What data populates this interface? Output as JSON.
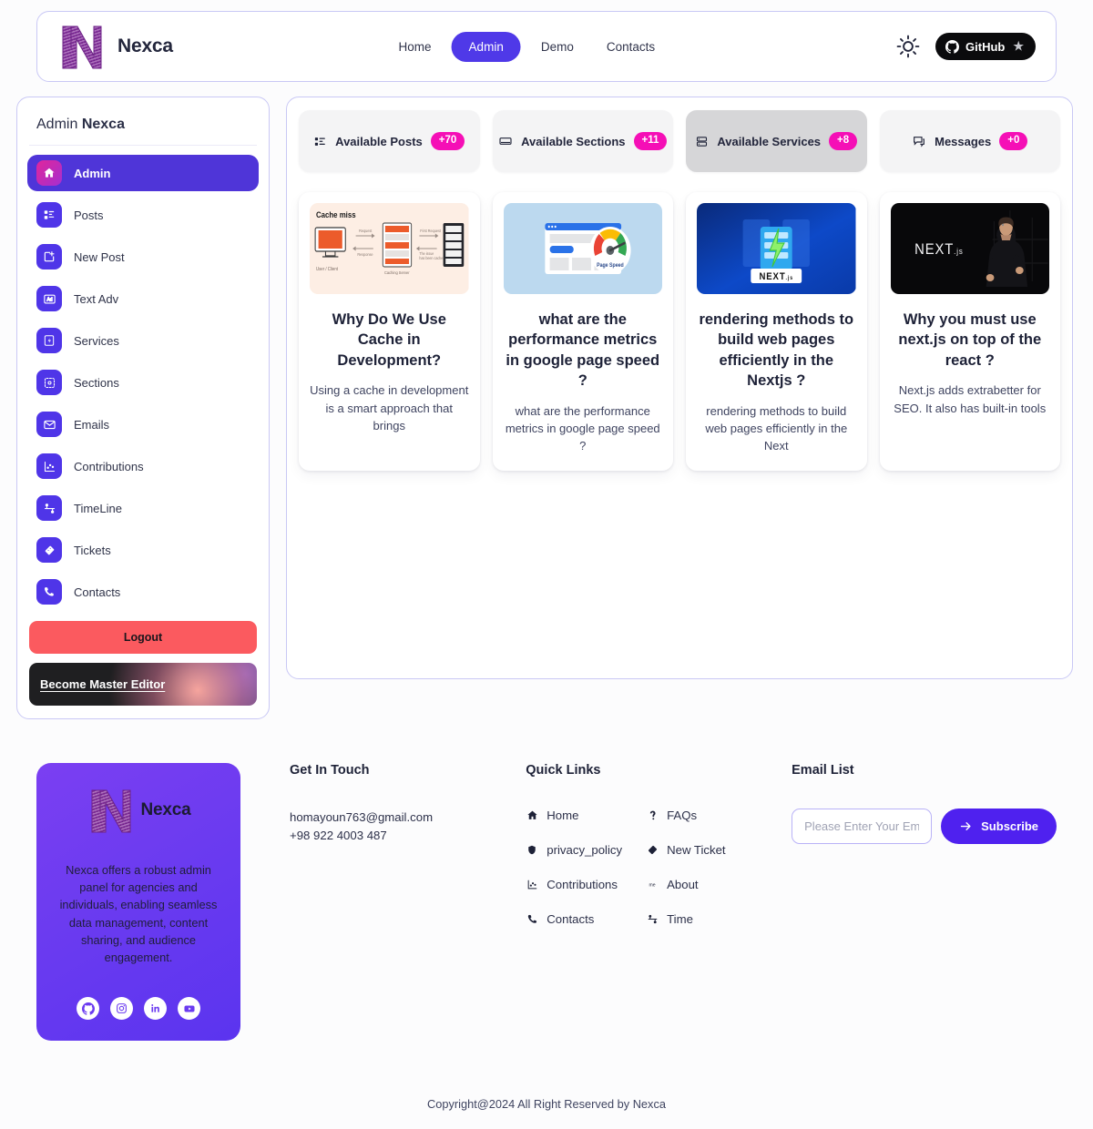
{
  "header": {
    "brand_name": "Nexca",
    "logo_icon": "nexca-n-logo",
    "nav": [
      {
        "label": "Home",
        "active": false
      },
      {
        "label": "Admin",
        "active": true
      },
      {
        "label": "Demo",
        "active": false
      },
      {
        "label": "Contacts",
        "active": false
      }
    ],
    "theme_toggle_icon": "sun-icon",
    "github_label": "GitHub",
    "github_icon": "github-icon",
    "star_icon": "star-icon"
  },
  "sidebar": {
    "title_prefix": "Admin",
    "title_brand": "Nexca",
    "items": [
      {
        "label": "Admin",
        "icon": "home-icon",
        "active": true
      },
      {
        "label": "Posts",
        "icon": "list-icon",
        "active": false
      },
      {
        "label": "New Post",
        "icon": "new-post-icon",
        "active": false
      },
      {
        "label": "Text Adv",
        "icon": "text-ad-icon",
        "active": false
      },
      {
        "label": "Services",
        "icon": "lightning-icon",
        "active": false
      },
      {
        "label": "Sections",
        "icon": "sections-icon",
        "active": false
      },
      {
        "label": "Emails",
        "icon": "envelope-icon",
        "active": false
      },
      {
        "label": "Contributions",
        "icon": "chart-icon",
        "active": false
      },
      {
        "label": "TimeLine",
        "icon": "timeline-icon",
        "active": false
      },
      {
        "label": "Tickets",
        "icon": "ticket-icon",
        "active": false
      },
      {
        "label": "Contacts",
        "icon": "phone-icon",
        "active": false
      }
    ],
    "logout_label": "Logout",
    "master_editor_label": "Become Master Editor"
  },
  "stats": [
    {
      "label": "Available Posts",
      "badge": "+70",
      "icon": "list-icon",
      "highlighted": false
    },
    {
      "label": "Available Sections",
      "badge": "+11",
      "icon": "section-icon",
      "highlighted": false
    },
    {
      "label": "Available Services",
      "badge": "+8",
      "icon": "server-icon",
      "highlighted": true
    },
    {
      "label": "Messages",
      "badge": "+0",
      "icon": "message-icon",
      "highlighted": false
    }
  ],
  "posts": [
    {
      "title": "Why Do We Use Cache in Development?",
      "desc": "Using a cache in development is a smart approach that brings",
      "thumb": "cache-miss-diagram"
    },
    {
      "title": "what are the performance metrics in google page speed ?",
      "desc": "what are the performance metrics in google page speed ?",
      "thumb": "page-speed-gauge"
    },
    {
      "title": "rendering methods to build web pages efficiently in the Nextjs ?",
      "desc": "rendering methods to build web pages efficiently in the Next",
      "thumb": "nextjs-server-blue"
    },
    {
      "title": "Why you must use next.js on top of the react ?",
      "desc": "Next.js adds extrabetter for SEO. It also has built-in tools",
      "thumb": "nextjs-speaker-black"
    }
  ],
  "footer": {
    "brand_name": "Nexca",
    "description": "Nexca offers a robust admin panel for agencies and individuals, enabling seamless data management, content sharing, and audience engagement.",
    "socials": [
      {
        "icon": "github-icon"
      },
      {
        "icon": "instagram-icon"
      },
      {
        "icon": "linkedin-icon"
      },
      {
        "icon": "youtube-icon"
      }
    ],
    "get_in_touch": {
      "title": "Get In Touch",
      "email": "homayoun763@gmail.com",
      "phone": "+98 922 4003 487"
    },
    "quick_links": {
      "title": "Quick Links",
      "col1": [
        {
          "label": "Home",
          "icon": "home-icon"
        },
        {
          "label": "privacy_policy",
          "icon": "shield-icon"
        },
        {
          "label": "Contributions",
          "icon": "chart-icon"
        },
        {
          "label": "Contacts",
          "icon": "phone-icon"
        }
      ],
      "col2": [
        {
          "label": "FAQs",
          "icon": "question-icon"
        },
        {
          "label": "New Ticket",
          "icon": "ticket-icon"
        },
        {
          "label": "About",
          "icon": "me-icon"
        },
        {
          "label": "Time",
          "icon": "timeline-icon"
        }
      ]
    },
    "email_list": {
      "title": "Email List",
      "placeholder": "Please Enter Your Em",
      "value": "",
      "subscribe_label": "Subscribe",
      "arrow_icon": "arrow-right-icon"
    },
    "copyright": "Copyright@2024 All Right Reserved by Nexca"
  },
  "colors": {
    "accent_indigo": "#4f39e8",
    "badge_pink": "#f50fb6",
    "logout_red": "#fb5a5f",
    "panel_border": "#c9c8f5"
  }
}
